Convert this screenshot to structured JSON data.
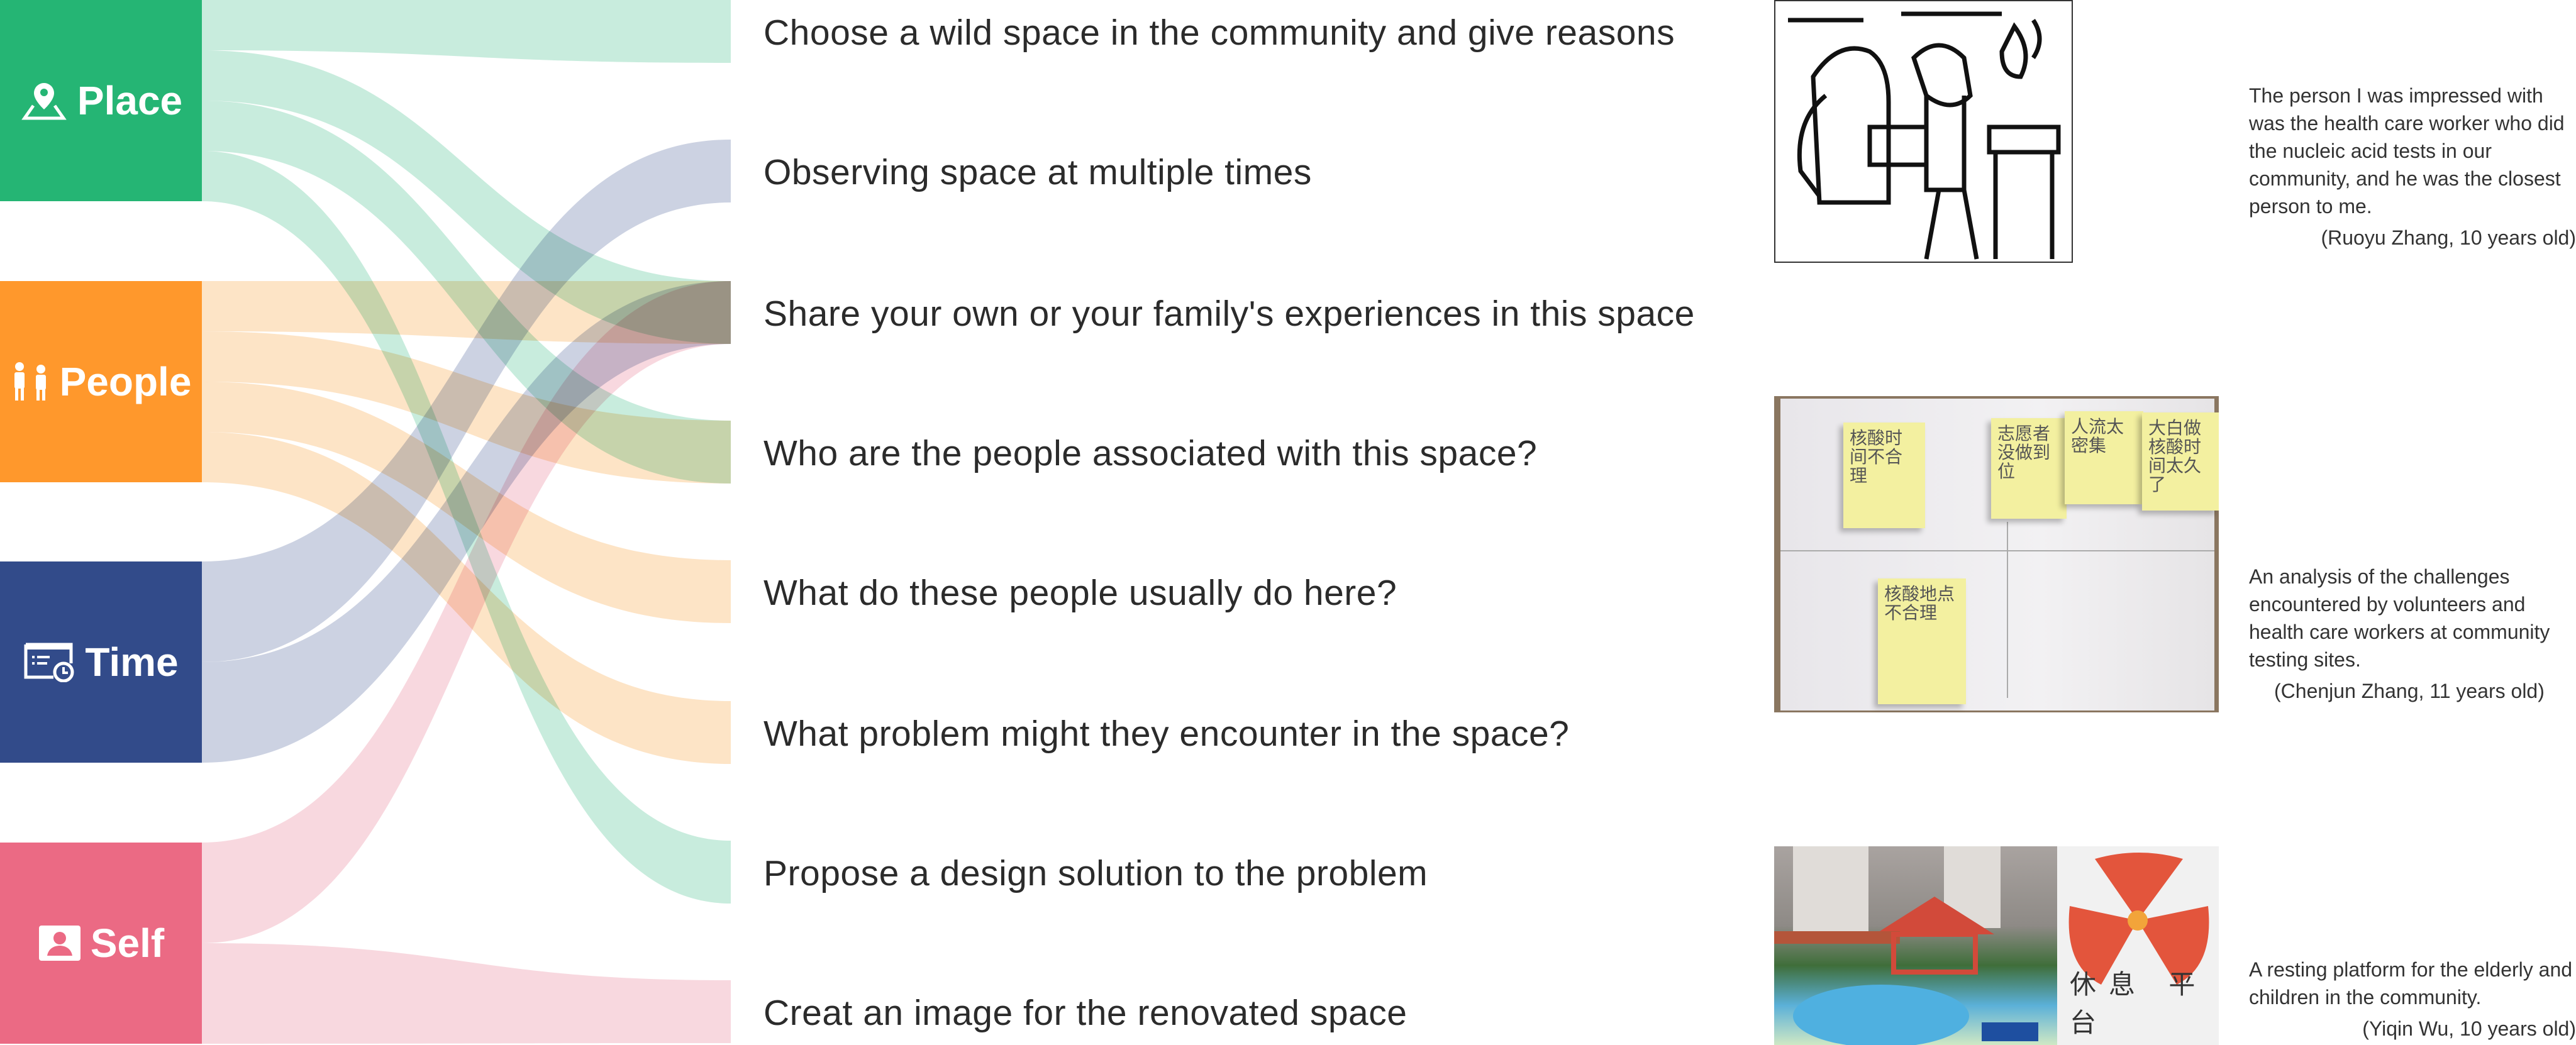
{
  "nodes": [
    {
      "id": "place",
      "label": "Place",
      "icon": "map-pin-icon",
      "color": "#25b574",
      "flow_color": "#c8ecdd"
    },
    {
      "id": "people",
      "label": "People",
      "icon": "people-icon",
      "color": "#ff982c",
      "flow_color": "#fde4c6"
    },
    {
      "id": "time",
      "label": "Time",
      "icon": "calendar-clock-icon",
      "color": "#324b8a",
      "flow_color": "#ccd2e2"
    },
    {
      "id": "self",
      "label": "Self",
      "icon": "user-card-icon",
      "color": "#eb6a84",
      "flow_color": "#f8d8df"
    }
  ],
  "questions": [
    "Choose a wild space in the community and give reasons",
    "Observing space at multiple times",
    "Share your own or your family's experiences in this space",
    "Who are the people associated with this space?",
    "What do these people usually do here?",
    "What problem might they encounter in the space?",
    "Propose a design solution to the problem",
    "Creat an image for the renovated space"
  ],
  "flows": [
    {
      "source": "place",
      "target": 0
    },
    {
      "source": "place",
      "target": 2
    },
    {
      "source": "place",
      "target": 3
    },
    {
      "source": "place",
      "target": 6
    },
    {
      "source": "people",
      "target": 2
    },
    {
      "source": "people",
      "target": 3
    },
    {
      "source": "people",
      "target": 4
    },
    {
      "source": "people",
      "target": 5
    },
    {
      "source": "time",
      "target": 1
    },
    {
      "source": "time",
      "target": 2
    },
    {
      "source": "self",
      "target": 2
    },
    {
      "source": "self",
      "target": 7
    }
  ],
  "examples": [
    {
      "caption": "The person I was impressed with was the health care worker who did the nucleic acid tests in our community, and he was the closest person to me.",
      "author": "(Ruoyu Zhang, 10 years old)"
    },
    {
      "caption": "An analysis of the challenges encountered by volunteers and health care workers at community testing sites.",
      "author": "(Chenjun Zhang, 11 years old)",
      "sticky_notes": [
        "核酸时间不合理",
        "志愿者没做到位",
        "人流太密集",
        "大白做核酸时间太久了",
        "核酸地点不合理"
      ]
    },
    {
      "caption": "A resting platform for the elderly and children in the community.",
      "author": "(Yiqin Wu, 10 years old)",
      "drawing_label": "休息 平台"
    }
  ]
}
